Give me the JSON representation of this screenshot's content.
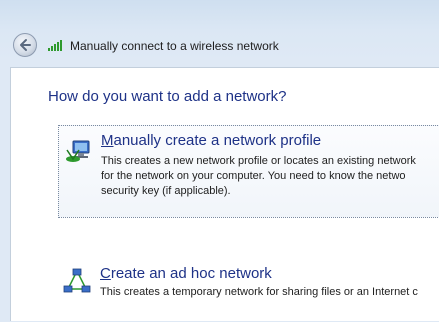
{
  "window": {
    "title": "Manually connect to a wireless network"
  },
  "icons": {
    "back": "back-arrow-icon",
    "signal": "wireless-signal-icon",
    "profile": "network-computer-icon",
    "adhoc": "ad-hoc-network-icon"
  },
  "main": {
    "heading": "How do you want to add a network?",
    "options": [
      {
        "accel": "M",
        "title_rest": "anually create a network profile",
        "desc_lines": [
          "This creates a new network profile or locates an existing network",
          "for the network on your computer. You need to know the netwo",
          "security key (if applicable)."
        ]
      },
      {
        "accel": "C",
        "title_rest": "reate an ad hoc network",
        "desc_lines": [
          "This creates a temporary network for sharing files or an Internet c"
        ]
      }
    ]
  },
  "colors": {
    "heading": "#1e3287",
    "window_bg": "#dfe9f5",
    "content_bg": "#ffffff"
  }
}
